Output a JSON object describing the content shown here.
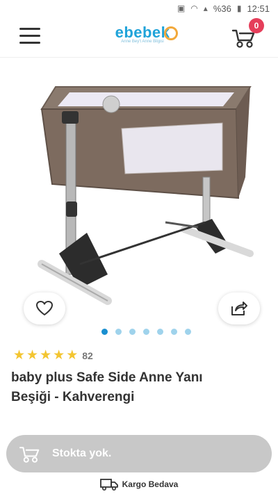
{
  "status_bar": {
    "signal": "%36",
    "time": "12:51"
  },
  "header": {
    "logo_text": "ebebek",
    "logo_tagline": "Anne Bey't Anne Bilgisi",
    "cart_count": "0"
  },
  "gallery": {
    "total_slides": 7,
    "active_slide": 1
  },
  "product": {
    "rating_count": "82",
    "stars": 5,
    "title_line1": "baby plus Safe Side Anne Yanı",
    "title_line2": "Beşiği - Kahverengi"
  },
  "stock": {
    "label": "Stokta yok."
  },
  "shipping": {
    "label": "Kargo Bedava"
  },
  "icons": {
    "menu": "hamburger-icon",
    "cart": "stroller-cart-icon",
    "favorite": "heart-icon",
    "share": "share-icon",
    "shipping": "truck-icon"
  },
  "colors": {
    "brand": "#1fa3d9",
    "badge": "#e53e5a",
    "star": "#f3c531",
    "stock_bar": "#c8c8c8"
  }
}
